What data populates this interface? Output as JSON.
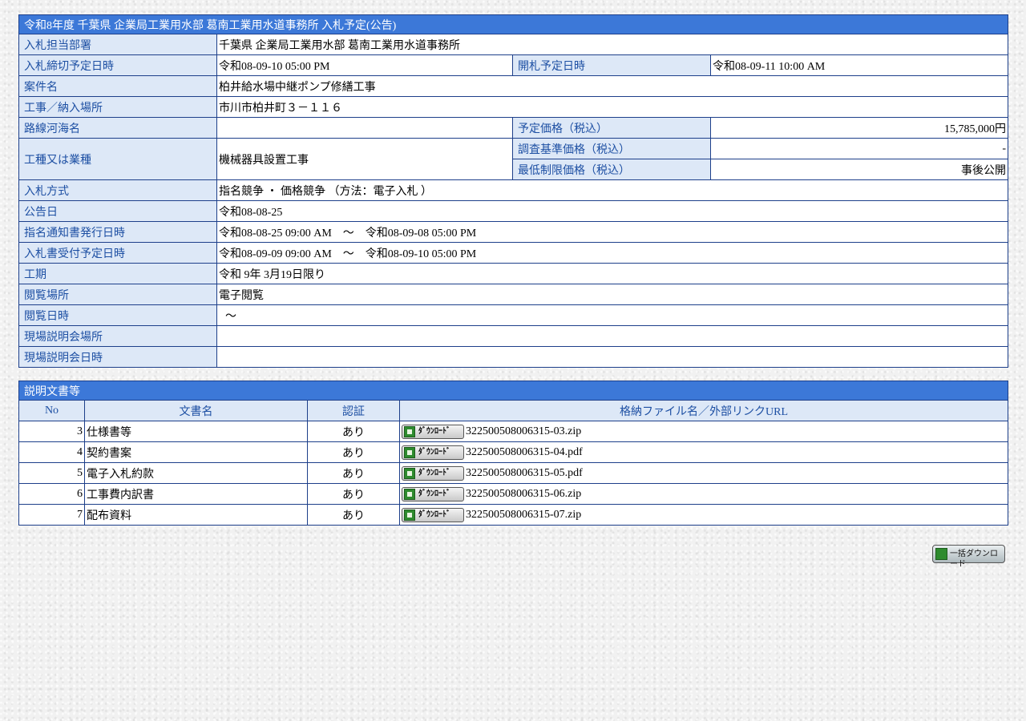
{
  "main": {
    "caption": "令和8年度  千葉県  企業局工業用水部  葛南工業用水道事務所  入札予定(公告)",
    "rows": {
      "department": {
        "label": "入札担当部署",
        "value": "千葉県  企業局工業用水部  葛南工業用水道事務所"
      },
      "deadline": {
        "label": "入札締切予定日時",
        "value": "令和08-09-10 05:00 PM"
      },
      "opening": {
        "label": "開札予定日時",
        "value": "令和08-09-11 10:00 AM"
      },
      "case_name": {
        "label": "案件名",
        "value": "柏井給水場中継ポンプ修繕工事"
      },
      "location": {
        "label": "工事／納入場所",
        "value": "市川市柏井町３－１１６"
      },
      "route": {
        "label": "路線河海名",
        "value": ""
      },
      "planned_price": {
        "label": "予定価格（税込）",
        "value": "15,785,000円"
      },
      "work_type": {
        "label": "工種又は業種",
        "value": "機械器具設置工事"
      },
      "survey_price": {
        "label": "調査基準価格（税込）",
        "value": "-"
      },
      "min_price": {
        "label": "最低制限価格（税込）",
        "value": "事後公開"
      },
      "bid_method": {
        "label": "入札方式",
        "value": "指名競争 ・ 価格競争 （方法：電子入札 ）"
      },
      "notice_date": {
        "label": "公告日",
        "value": "令和08-08-25"
      },
      "nomination": {
        "label": "指名通知書発行日時",
        "value": "令和08-08-25 09:00 AM　～　令和08-09-08 05:00 PM"
      },
      "acceptance": {
        "label": "入札書受付予定日時",
        "value": "令和08-09-09 09:00 AM　～　令和08-09-10 05:00 PM"
      },
      "period": {
        "label": "工期",
        "value": "令和 9年 3月19日限り"
      },
      "view_place": {
        "label": "閲覧場所",
        "value": "電子閲覧"
      },
      "view_date": {
        "label": "閲覧日時",
        "value": "～"
      },
      "briefing_place": {
        "label": "現場説明会場所",
        "value": ""
      },
      "briefing_date": {
        "label": "現場説明会日時",
        "value": ""
      }
    }
  },
  "docs": {
    "caption": "説明文書等",
    "headers": {
      "no": "No",
      "name": "文書名",
      "auth": "認証",
      "file": "格納ファイル名／外部リンクURL"
    },
    "download_label": "ﾀﾞｳﾝﾛｰﾄﾞ",
    "rows": [
      {
        "no": "3",
        "name": "仕様書等",
        "auth": "あり",
        "file": "322500508006315-03.zip"
      },
      {
        "no": "4",
        "name": "契約書案",
        "auth": "あり",
        "file": "322500508006315-04.pdf"
      },
      {
        "no": "5",
        "name": "電子入札約款",
        "auth": "あり",
        "file": "322500508006315-05.pdf"
      },
      {
        "no": "6",
        "name": "工事費内訳書",
        "auth": "あり",
        "file": "322500508006315-06.zip"
      },
      {
        "no": "7",
        "name": "配布資料",
        "auth": "あり",
        "file": "322500508006315-07.zip"
      }
    ]
  },
  "bulk_download": {
    "label": "一括ダウンロード"
  }
}
